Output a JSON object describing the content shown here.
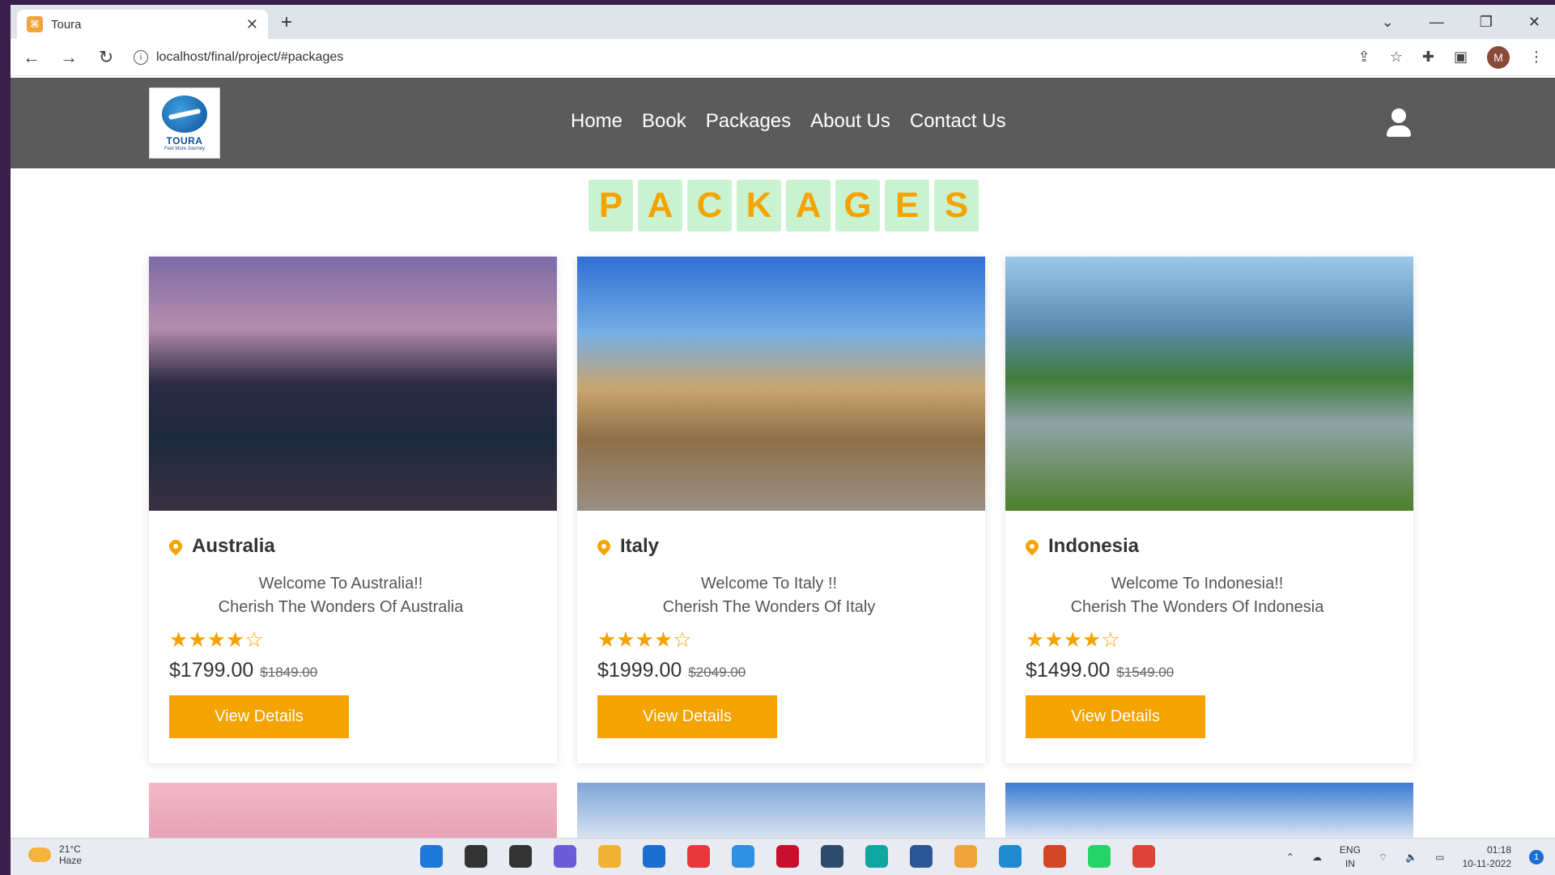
{
  "browser": {
    "tab_title": "Toura",
    "tab_close": "✕",
    "new_tab": "+",
    "url": "localhost/final/project/#packages",
    "win_minimize": "—",
    "win_restore": "❐",
    "win_close": "✕",
    "win_dropdown": "⌄",
    "profile_initial": "M"
  },
  "site": {
    "logo": {
      "brand": "TOURA",
      "tagline": "Feel More Journey"
    },
    "nav": [
      "Home",
      "Book",
      "Packages",
      "About Us",
      "Contact Us"
    ],
    "heading_letters": [
      "P",
      "A",
      "C",
      "K",
      "A",
      "G",
      "E",
      "S"
    ]
  },
  "packages": [
    {
      "location": "Australia",
      "line1": "Welcome To Australia!!",
      "line2": "Cherish The Wonders Of Australia",
      "rating": 4,
      "stars": "★★★★☆",
      "price": "$1799.00",
      "old_price": "$1849.00",
      "button": "View Details"
    },
    {
      "location": "Italy",
      "line1": "Welcome To Italy !!",
      "line2": "Cherish The Wonders Of Italy",
      "rating": 4,
      "stars": "★★★★☆",
      "price": "$1999.00",
      "old_price": "$2049.00",
      "button": "View Details"
    },
    {
      "location": "Indonesia",
      "line1": "Welcome To Indonesia!!",
      "line2": "Cherish The Wonders Of Indonesia",
      "rating": 4,
      "stars": "★★★★☆",
      "price": "$1499.00",
      "old_price": "$1549.00",
      "button": "View Details"
    }
  ],
  "taskbar": {
    "weather_temp": "21°C",
    "weather_desc": "Haze",
    "lang_top": "ENG",
    "lang_bottom": "IN",
    "time": "01:18",
    "date": "10-11-2022",
    "notif_count": "1",
    "app_colors": [
      "#1e78d7",
      "#333333",
      "#333333",
      "#6b5bd6",
      "#f2b233",
      "#1a6fd1",
      "#e8383d",
      "#2f8fe0",
      "#c8102e",
      "#2d4a6a",
      "#0fa5a0",
      "#2b5797",
      "#f2a33a",
      "#1f8ad2",
      "#d24726",
      "#25d366",
      "#db4437"
    ]
  }
}
